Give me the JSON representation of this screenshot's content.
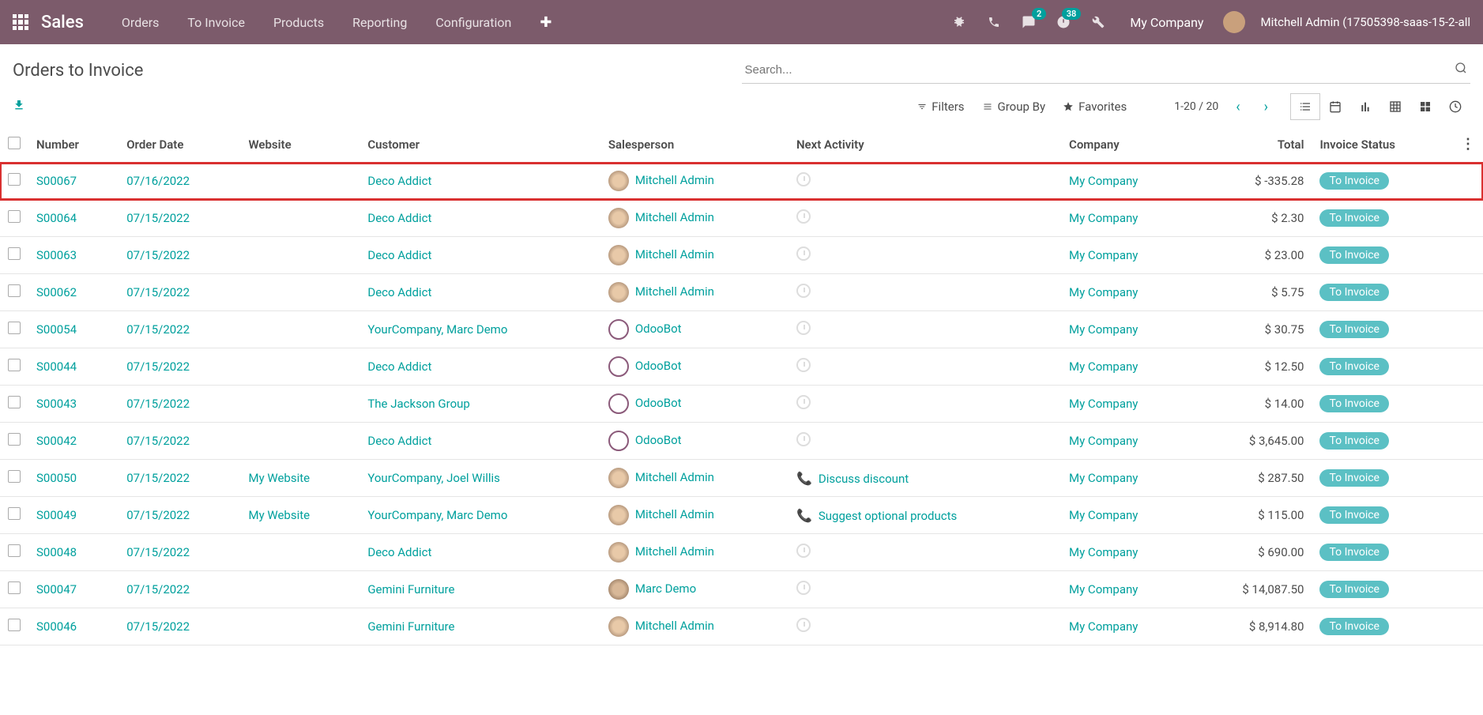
{
  "navbar": {
    "brand": "Sales",
    "menu": [
      "Orders",
      "To Invoice",
      "Products",
      "Reporting",
      "Configuration"
    ],
    "messages_badge": "2",
    "activities_badge": "38",
    "company": "My Company",
    "user": "Mitchell Admin (17505398-saas-15-2-all"
  },
  "breadcrumb": "Orders to Invoice",
  "search": {
    "placeholder": "Search..."
  },
  "filters": {
    "filters": "Filters",
    "groupby": "Group By",
    "favorites": "Favorites"
  },
  "pager": {
    "range": "1-20 / 20"
  },
  "columns": {
    "number": "Number",
    "order_date": "Order Date",
    "website": "Website",
    "customer": "Customer",
    "salesperson": "Salesperson",
    "next_activity": "Next Activity",
    "company": "Company",
    "total": "Total",
    "invoice_status": "Invoice Status"
  },
  "rows": [
    {
      "number": "S00067",
      "date": "07/16/2022",
      "website": "",
      "customer": "Deco Addict",
      "sp": "Mitchell Admin",
      "sp_type": "mitchell",
      "activity": "",
      "company": "My Company",
      "total": "$ -335.28",
      "status": "To Invoice",
      "highlight": true
    },
    {
      "number": "S00064",
      "date": "07/15/2022",
      "website": "",
      "customer": "Deco Addict",
      "sp": "Mitchell Admin",
      "sp_type": "mitchell",
      "activity": "",
      "company": "My Company",
      "total": "$ 2.30",
      "status": "To Invoice"
    },
    {
      "number": "S00063",
      "date": "07/15/2022",
      "website": "",
      "customer": "Deco Addict",
      "sp": "Mitchell Admin",
      "sp_type": "mitchell",
      "activity": "",
      "company": "My Company",
      "total": "$ 23.00",
      "status": "To Invoice"
    },
    {
      "number": "S00062",
      "date": "07/15/2022",
      "website": "",
      "customer": "Deco Addict",
      "sp": "Mitchell Admin",
      "sp_type": "mitchell",
      "activity": "",
      "company": "My Company",
      "total": "$ 5.75",
      "status": "To Invoice"
    },
    {
      "number": "S00054",
      "date": "07/15/2022",
      "website": "",
      "customer": "YourCompany, Marc Demo",
      "sp": "OdooBot",
      "sp_type": "odoobot",
      "activity": "",
      "company": "My Company",
      "total": "$ 30.75",
      "status": "To Invoice"
    },
    {
      "number": "S00044",
      "date": "07/15/2022",
      "website": "",
      "customer": "Deco Addict",
      "sp": "OdooBot",
      "sp_type": "odoobot",
      "activity": "",
      "company": "My Company",
      "total": "$ 12.50",
      "status": "To Invoice"
    },
    {
      "number": "S00043",
      "date": "07/15/2022",
      "website": "",
      "customer": "The Jackson Group",
      "sp": "OdooBot",
      "sp_type": "odoobot",
      "activity": "",
      "company": "My Company",
      "total": "$ 14.00",
      "status": "To Invoice"
    },
    {
      "number": "S00042",
      "date": "07/15/2022",
      "website": "",
      "customer": "Deco Addict",
      "sp": "OdooBot",
      "sp_type": "odoobot",
      "activity": "",
      "company": "My Company",
      "total": "$ 3,645.00",
      "status": "To Invoice"
    },
    {
      "number": "S00050",
      "date": "07/15/2022",
      "website": "My Website",
      "customer": "YourCompany, Joel Willis",
      "sp": "Mitchell Admin",
      "sp_type": "mitchell",
      "activity": "Discuss discount",
      "activity_type": "phone",
      "company": "My Company",
      "total": "$ 287.50",
      "status": "To Invoice"
    },
    {
      "number": "S00049",
      "date": "07/15/2022",
      "website": "My Website",
      "customer": "YourCompany, Marc Demo",
      "sp": "Mitchell Admin",
      "sp_type": "mitchell",
      "activity": "Suggest optional products",
      "activity_type": "phone",
      "company": "My Company",
      "total": "$ 115.00",
      "status": "To Invoice"
    },
    {
      "number": "S00048",
      "date": "07/15/2022",
      "website": "",
      "customer": "Deco Addict",
      "sp": "Mitchell Admin",
      "sp_type": "mitchell",
      "activity": "",
      "company": "My Company",
      "total": "$ 690.00",
      "status": "To Invoice"
    },
    {
      "number": "S00047",
      "date": "07/15/2022",
      "website": "",
      "customer": "Gemini Furniture",
      "sp": "Marc Demo",
      "sp_type": "marc",
      "activity": "",
      "company": "My Company",
      "total": "$ 14,087.50",
      "status": "To Invoice"
    },
    {
      "number": "S00046",
      "date": "07/15/2022",
      "website": "",
      "customer": "Gemini Furniture",
      "sp": "Mitchell Admin",
      "sp_type": "mitchell",
      "activity": "",
      "company": "My Company",
      "total": "$ 8,914.80",
      "status": "To Invoice"
    }
  ]
}
